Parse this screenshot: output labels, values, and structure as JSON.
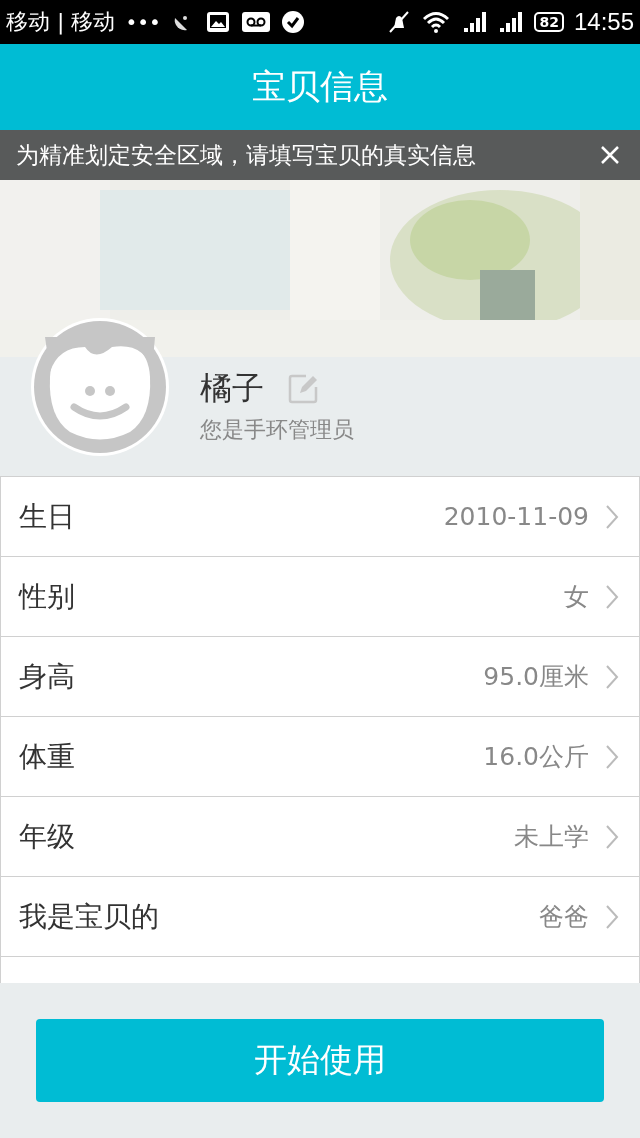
{
  "status_bar": {
    "carrier": "移动 | 移动",
    "more": "•••",
    "battery": "82",
    "time": "14:55"
  },
  "header": {
    "title": "宝贝信息"
  },
  "notice": {
    "text": "为精准划定安全区域，请填写宝贝的真实信息"
  },
  "profile": {
    "name": "橘子",
    "role": "您是手环管理员"
  },
  "fields": [
    {
      "label": "生日",
      "value": "2010-11-09"
    },
    {
      "label": "性别",
      "value": "女"
    },
    {
      "label": "身高",
      "value": "95.0厘米"
    },
    {
      "label": "体重",
      "value": "16.0公斤"
    },
    {
      "label": "年级",
      "value": "未上学"
    },
    {
      "label": "我是宝贝的",
      "value": "爸爸"
    }
  ],
  "start_button": {
    "label": "开始使用"
  }
}
